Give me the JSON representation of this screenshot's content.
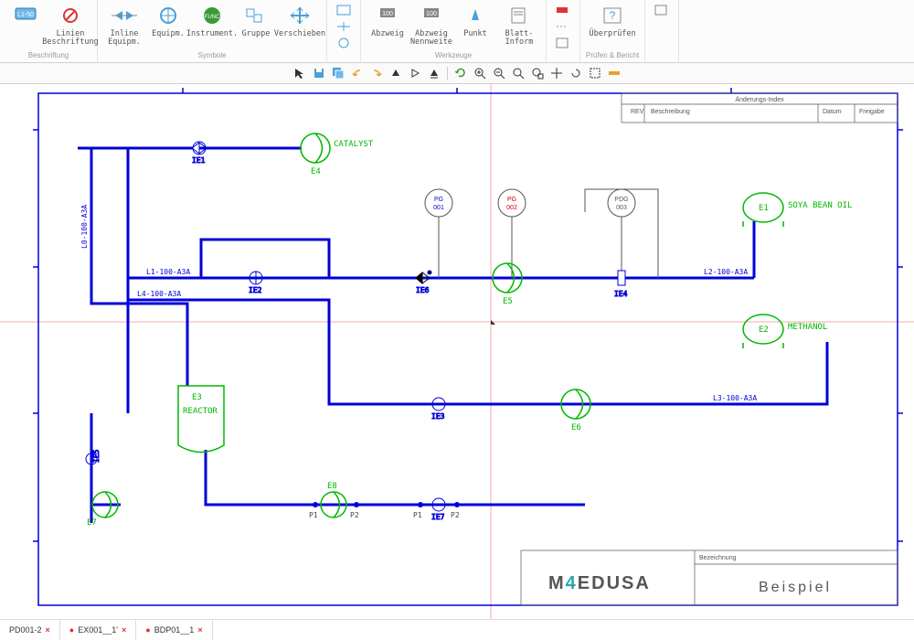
{
  "ribbon": {
    "groups": [
      {
        "label": "Beschriftung",
        "items": [
          {
            "name": "tag-l150",
            "label": "",
            "icon": "tag"
          },
          {
            "name": "linien-beschriftung",
            "label": "Linien\nBeschriftung",
            "icon": "lines"
          }
        ]
      },
      {
        "label": "",
        "items": [
          {
            "name": "inline-equipm",
            "label": "Inline\nEquipm.",
            "icon": "valve"
          },
          {
            "name": "equipm",
            "label": "Equipm.",
            "icon": "valve2"
          },
          {
            "name": "instrument",
            "label": "Instrument.",
            "icon": "circle"
          },
          {
            "name": "gruppe",
            "label": "Gruppe",
            "icon": "grp"
          },
          {
            "name": "verschieben",
            "label": "Verschieben",
            "icon": "move"
          }
        ]
      },
      {
        "label": "",
        "small": true,
        "items": [
          {
            "name": "sym-a",
            "label": "",
            "icon": "s1"
          },
          {
            "name": "sym-b",
            "label": "",
            "icon": "s2"
          },
          {
            "name": "sym-c",
            "label": "",
            "icon": "s3"
          },
          {
            "name": "sym-d",
            "label": "",
            "icon": "s4"
          }
        ]
      },
      {
        "label": "Werkzeuge",
        "items": [
          {
            "name": "abzweig",
            "label": "Abzweig",
            "icon": "branch"
          },
          {
            "name": "abzweig-nennweite",
            "label": "Abzweig\nNennweite",
            "icon": "branch2"
          },
          {
            "name": "punkt",
            "label": "Punkt",
            "icon": "point"
          },
          {
            "name": "blatt-inform",
            "label": "Blatt-\nInform",
            "icon": "sheet"
          }
        ]
      },
      {
        "label": "",
        "small": true,
        "items": [
          {
            "name": "tool-a",
            "label": "",
            "icon": "ta"
          },
          {
            "name": "tool-b",
            "label": "",
            "icon": "tb"
          },
          {
            "name": "tool-c",
            "label": "",
            "icon": "tc"
          }
        ]
      },
      {
        "label": "Prüfen & Bericht",
        "items": [
          {
            "name": "uberprufen",
            "label": "Überprüfen",
            "icon": "check"
          }
        ]
      },
      {
        "label": "",
        "small": true,
        "items": [
          {
            "name": "opt-a",
            "label": "",
            "icon": "oa"
          }
        ]
      }
    ]
  },
  "toolbar2": [
    "cursor",
    "save",
    "saveall",
    "undo",
    "redo",
    "t1",
    "t2",
    "t3",
    "sep",
    "refresh",
    "zoomin",
    "zoomout",
    "zoomfit",
    "zoomwin",
    "pan",
    "rot",
    "sel",
    "mea"
  ],
  "tabs": [
    {
      "name": "PD001-2",
      "close": true
    },
    {
      "name": "EX001__1'",
      "close": true
    },
    {
      "name": "BDP01__1",
      "close": true
    }
  ],
  "drawing": {
    "title_index": {
      "header": "Änderungs-Index",
      "cols": [
        "REV",
        "Beschreibung",
        "Datum",
        "Freigabe"
      ]
    },
    "title_block": {
      "brand": "M4EDUSA",
      "label": "Bezeichnung",
      "value": "Beispiel"
    },
    "equipment": [
      {
        "id": "E1",
        "tag": "SOYA BEAN OIL"
      },
      {
        "id": "E2",
        "tag": "METHANOL"
      },
      {
        "id": "E3",
        "tag": "REACTOR"
      },
      {
        "id": "E4",
        "tag": "CATALYST"
      },
      {
        "id": "E5",
        "tag": ""
      },
      {
        "id": "E6",
        "tag": ""
      },
      {
        "id": "E7",
        "tag": ""
      },
      {
        "id": "E8",
        "tag": ""
      }
    ],
    "inline": [
      "IE1",
      "IE2",
      "IE3",
      "IE4",
      "IE5",
      "IE6",
      "IE7"
    ],
    "instruments": [
      {
        "tag": "PG",
        "num": "001",
        "color": "#0000d8"
      },
      {
        "tag": "PG",
        "num": "002",
        "color": "#d00000"
      },
      {
        "tag": "PDG",
        "num": "003",
        "color": "#555"
      }
    ],
    "lines": [
      "L0-100-A3A",
      "L1-100-A3A",
      "L2-100-A3A",
      "L3-100-A3A",
      "L4-100-A3A"
    ],
    "points": [
      "P1",
      "P2"
    ]
  }
}
